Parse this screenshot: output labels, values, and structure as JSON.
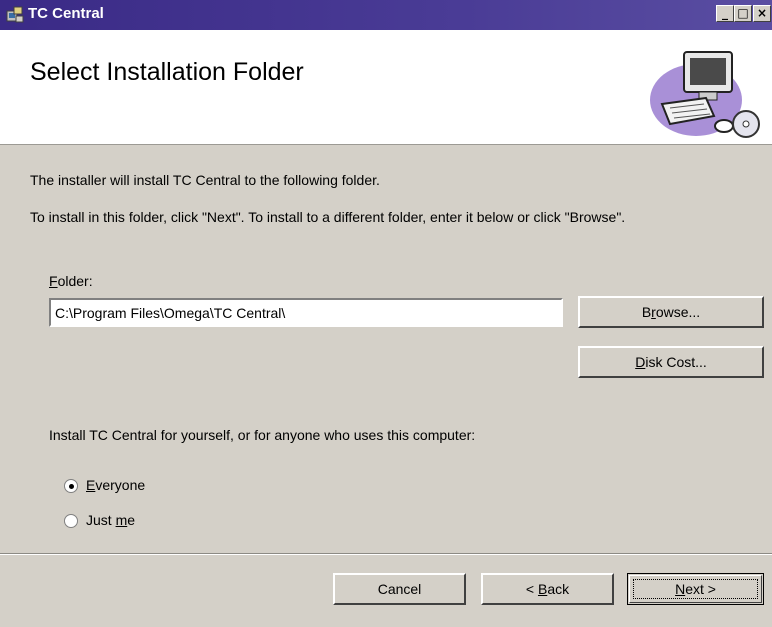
{
  "window": {
    "title": "TC Central",
    "controls": {
      "minimize": "_",
      "maximize": "□",
      "close": "×"
    }
  },
  "banner": {
    "title": "Select Installation Folder",
    "graphic": "computer-with-cd-icon"
  },
  "body": {
    "line1": "The installer will install TC Central to the following folder.",
    "line2": "To install in this folder, click \"Next\". To install to a different folder, enter it below or click \"Browse\"."
  },
  "folder": {
    "label_mnemonic": "F",
    "label_rest": "older:",
    "value": "C:\\Program Files\\Omega\\TC Central\\"
  },
  "buttons": {
    "browse_pre": "B",
    "browse_mn": "r",
    "browse_post": "owse...",
    "diskcost_mn": "D",
    "diskcost_post": "isk Cost...",
    "cancel": "Cancel",
    "back_pre": "< ",
    "back_mn": "B",
    "back_post": "ack",
    "next_mn": "N",
    "next_post": "ext >"
  },
  "install_for": {
    "prompt": "Install TC Central for yourself, or for anyone who uses this computer:",
    "options": [
      {
        "pre": "",
        "mn": "E",
        "post": "veryone",
        "selected": true
      },
      {
        "pre": "Just ",
        "mn": "m",
        "post": "e",
        "selected": false
      }
    ]
  }
}
